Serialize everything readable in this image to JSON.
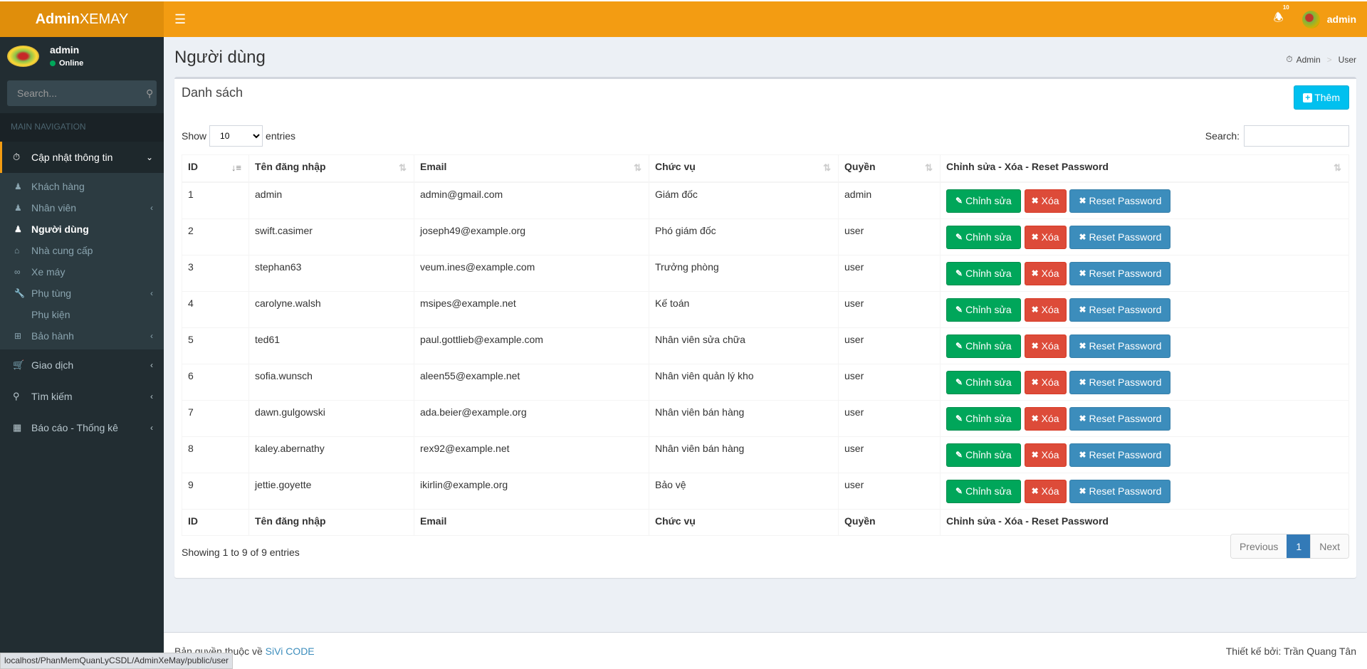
{
  "header": {
    "logo_bold": "Admin",
    "logo_rest": "XEMAY",
    "notifications_count": "10",
    "user_name": "admin"
  },
  "sidebar": {
    "user_name": "admin",
    "status": "Online",
    "search_placeholder": "Search...",
    "nav_header": "MAIN NAVIGATION",
    "menu": [
      {
        "label": "Cập nhật thông tin",
        "icon": "dashboard-icon",
        "expanded": true,
        "children": [
          {
            "label": "Khách hàng",
            "icon": "user-tie-icon"
          },
          {
            "label": "Nhân viên",
            "icon": "user-secret-icon",
            "has_children": true
          },
          {
            "label": "Người dùng",
            "icon": "user-icon",
            "active": true
          },
          {
            "label": "Nhà cung cấp",
            "icon": "home-icon"
          },
          {
            "label": "Xe máy",
            "icon": "motorcycle-icon"
          },
          {
            "label": "Phụ tùng",
            "icon": "wrench-icon",
            "has_children": true
          },
          {
            "label": "Phụ kiện",
            "icon": ""
          },
          {
            "label": "Bảo hành",
            "icon": "plus-square-icon",
            "has_children": true
          }
        ]
      },
      {
        "label": "Giao dịch",
        "icon": "cart-icon"
      },
      {
        "label": "Tìm kiếm",
        "icon": "search-icon"
      },
      {
        "label": "Báo cáo - Thống kê",
        "icon": "calendar-icon"
      }
    ]
  },
  "page": {
    "title": "Người dùng",
    "breadcrumb": [
      "Admin",
      "User"
    ]
  },
  "box": {
    "title": "Danh sách",
    "add_label": "Thêm",
    "show_label": "Show",
    "entries_label": "entries",
    "length_value": "10",
    "search_label": "Search:",
    "search_value": ""
  },
  "table": {
    "columns": [
      "ID",
      "Tên đăng nhập",
      "Email",
      "Chức vụ",
      "Quyền",
      "Chỉnh sửa - Xóa - Reset Password"
    ],
    "rows": [
      {
        "id": "1",
        "username": "admin",
        "email": "admin@gmail.com",
        "position": "Giám đốc",
        "role": "admin"
      },
      {
        "id": "2",
        "username": "swift.casimer",
        "email": "joseph49@example.org",
        "position": "Phó giám đốc",
        "role": "user"
      },
      {
        "id": "3",
        "username": "stephan63",
        "email": "veum.ines@example.com",
        "position": "Trưởng phòng",
        "role": "user"
      },
      {
        "id": "4",
        "username": "carolyne.walsh",
        "email": "msipes@example.net",
        "position": "Kế toán",
        "role": "user"
      },
      {
        "id": "5",
        "username": "ted61",
        "email": "paul.gottlieb@example.com",
        "position": "Nhân viên sửa chữa",
        "role": "user"
      },
      {
        "id": "6",
        "username": "sofia.wunsch",
        "email": "aleen55@example.net",
        "position": "Nhân viên quản lý kho",
        "role": "user"
      },
      {
        "id": "7",
        "username": "dawn.gulgowski",
        "email": "ada.beier@example.org",
        "position": "Nhân viên bán hàng",
        "role": "user"
      },
      {
        "id": "8",
        "username": "kaley.abernathy",
        "email": "rex92@example.net",
        "position": "Nhân viên bán hàng",
        "role": "user"
      },
      {
        "id": "9",
        "username": "jettie.goyette",
        "email": "ikirlin@example.org",
        "position": "Bảo vệ",
        "role": "user"
      }
    ],
    "actions": {
      "edit": "Chỉnh sửa",
      "delete": "Xóa",
      "reset": "Reset Password"
    }
  },
  "info": "Showing 1 to 9 of 9 entries",
  "pagination": {
    "previous": "Previous",
    "current": "1",
    "next": "Next"
  },
  "footer": {
    "copyright_prefix": "Bản quyền thuộc về",
    "copyright_link": "SiVi CODE",
    "designer": "Thiết kế bởi: Trần Quang Tân"
  },
  "statusbar": "localhost/PhanMemQuanLyCSDL/AdminXeMay/public/user",
  "colors": {
    "header": "#f39c12",
    "logo": "#e08e0b",
    "sidebar": "#222d32",
    "edit": "#00a65a",
    "delete": "#dd4b39",
    "reset": "#3c8dbc",
    "add": "#00c0ef"
  }
}
